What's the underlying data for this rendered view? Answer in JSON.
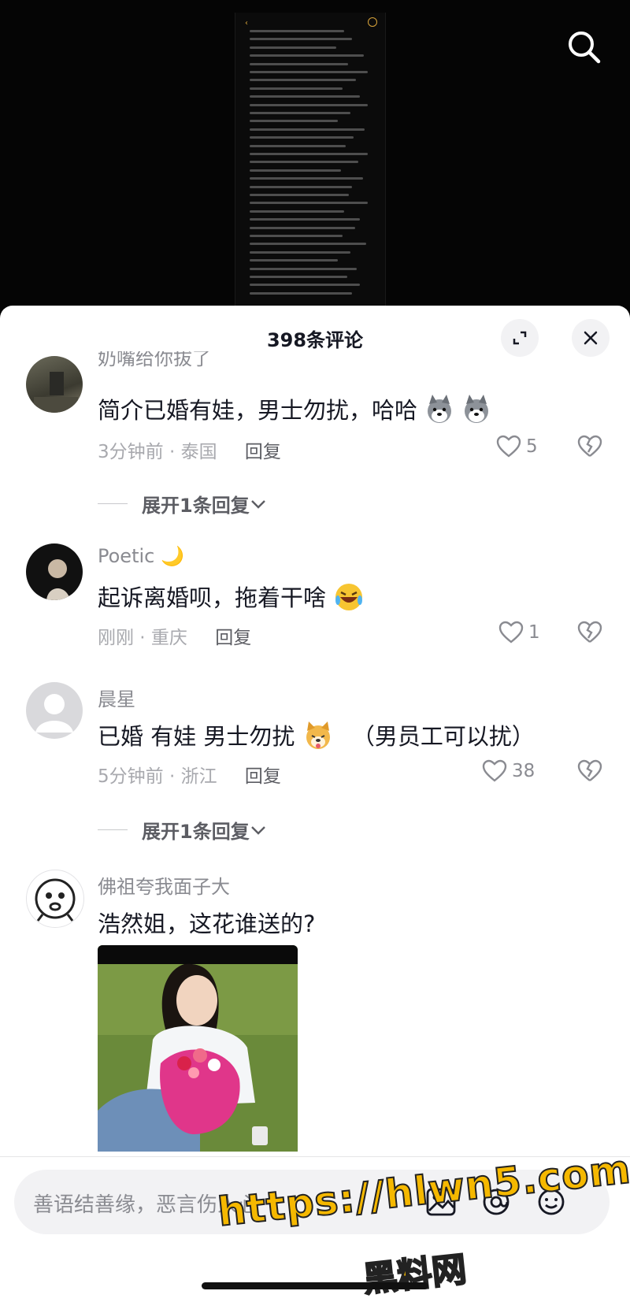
{
  "header": {
    "title": "398条评论"
  },
  "comments": [
    {
      "username": "奶嘴给你拔了",
      "text": "简介已婚有娃，男士勿扰，哈哈",
      "time": "3分钟前 · 泰国",
      "reply_label": "回复",
      "likes": "5",
      "expand_label": "展开1条回复"
    },
    {
      "username": "Poetic",
      "text": "起诉离婚呗，拖着干啥",
      "time": "刚刚 · 重庆",
      "reply_label": "回复",
      "likes": "1"
    },
    {
      "username": "晨星",
      "text": "已婚 有娃 男士勿扰",
      "text_suffix": "（男员工可以扰）",
      "time": "5分钟前 · 浙江",
      "reply_label": "回复",
      "likes": "38",
      "expand_label": "展开1条回复"
    },
    {
      "username": "佛祖夸我面子大",
      "text": "浩然姐，这花谁送的?"
    }
  ],
  "input": {
    "placeholder": "善语结善缘，恶言伤人心"
  },
  "watermark": {
    "url": "https://hlwn5.com",
    "name": "黑料网"
  },
  "colors": {
    "accent": "#f5b800",
    "text_primary": "#161823",
    "text_secondary": "#8a8b91"
  }
}
